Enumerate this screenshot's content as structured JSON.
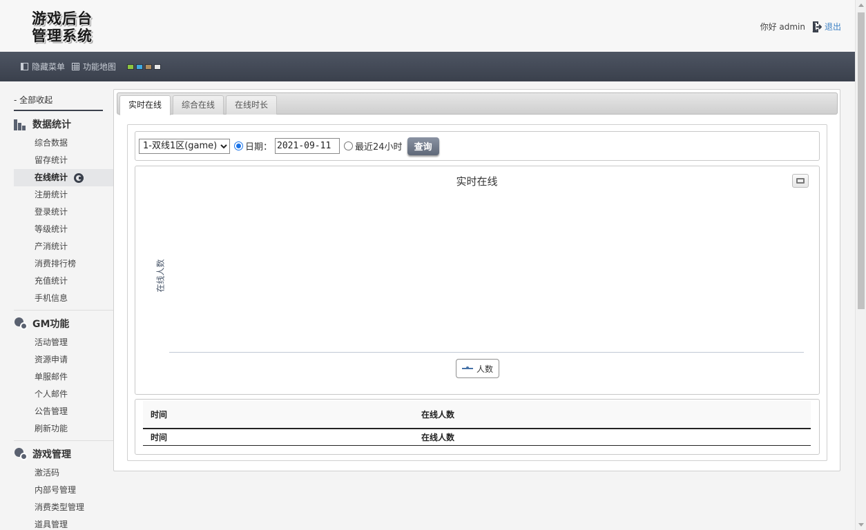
{
  "header": {
    "logo_line1": "游戏后台",
    "logo_line2": "管理系统",
    "greeting": "你好 admin",
    "logout": "退出"
  },
  "toolbar": {
    "hide_menu": "隐藏菜单",
    "function_map": "功能地图",
    "theme_colors": [
      "#8dc63f",
      "#3fa9e0",
      "#b08d5f",
      "#e8e8e8"
    ]
  },
  "sidebar": {
    "collapse_all": "- 全部收起",
    "groups": [
      {
        "title": "数据统计",
        "icon": "bar-chart-icon",
        "items": [
          "综合数据",
          "留存统计",
          "在线统计",
          "注册统计",
          "登录统计",
          "等级统计",
          "产消统计",
          "消费排行榜",
          "充值统计",
          "手机信息"
        ]
      },
      {
        "title": "GM功能",
        "icon": "gears-icon",
        "items": [
          "活动管理",
          "资源申请",
          "单服邮件",
          "个人邮件",
          "公告管理",
          "刷新功能"
        ]
      },
      {
        "title": "游戏管理",
        "icon": "gears-icon",
        "items": [
          "激活码",
          "内部号管理",
          "消费类型管理",
          "道具管理"
        ]
      }
    ],
    "active_item": "在线统计"
  },
  "tabs": [
    {
      "label": "实时在线",
      "active": true
    },
    {
      "label": "综合在线",
      "active": false
    },
    {
      "label": "在线时长",
      "active": false
    }
  ],
  "filter": {
    "server_selected": "1-双线1区(game)",
    "date_label": "日期：",
    "date_value": "2021-09-11",
    "last24_label": "最近24小时",
    "date_mode": "date",
    "query_button": "查询"
  },
  "chart_data": {
    "type": "line",
    "title": "实时在线",
    "ylabel": "在线人数",
    "xlabel": "",
    "series": [
      {
        "name": "人数",
        "values": []
      }
    ],
    "x": [],
    "legend_position": "bottom-center",
    "series_color": "#4572a7"
  },
  "table": {
    "headers": [
      "时间",
      "在线人数"
    ],
    "footers": [
      "时间",
      "在线人数"
    ],
    "rows": []
  }
}
